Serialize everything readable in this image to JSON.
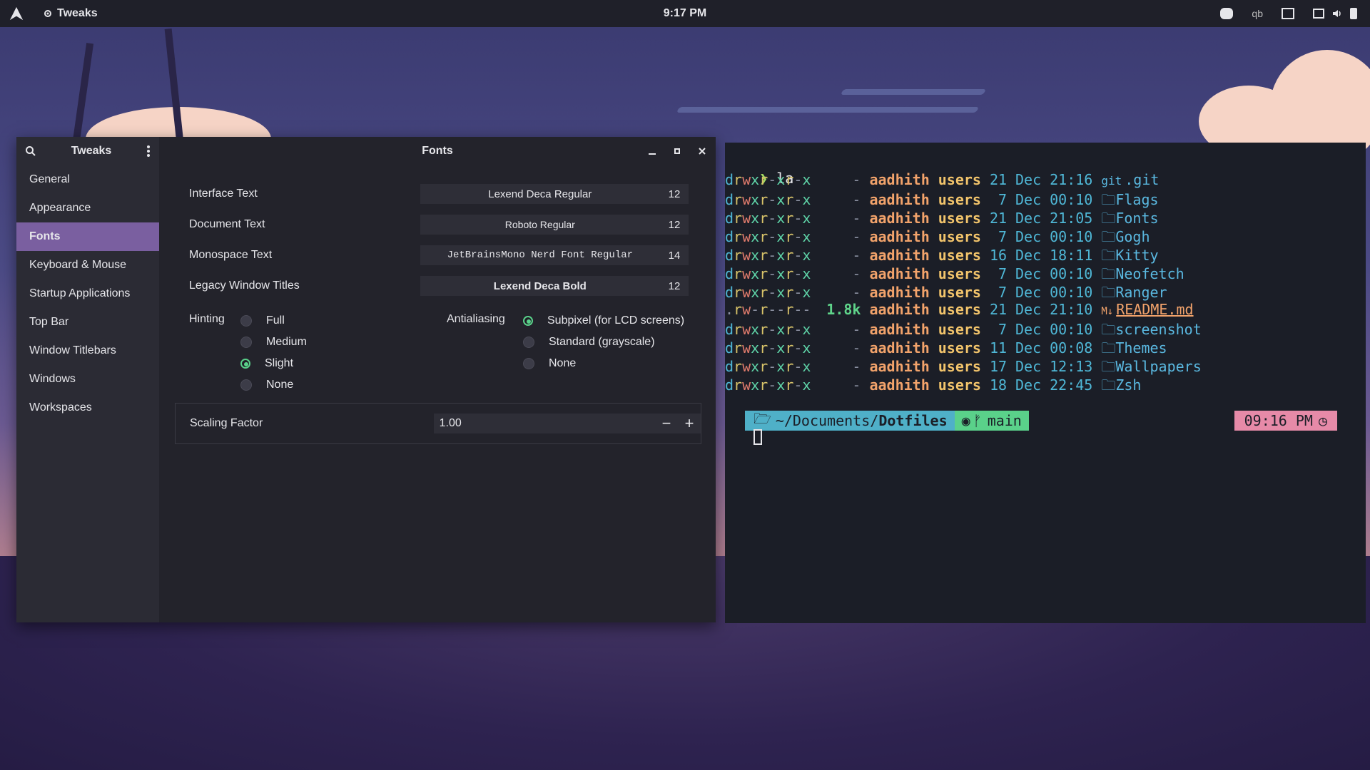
{
  "topbar": {
    "app_name": "Tweaks",
    "clock": "9:17 PM",
    "tray_qb": "qb"
  },
  "tweaks": {
    "title": "Tweaks",
    "panel_title": "Fonts",
    "sidebar": [
      {
        "label": "General"
      },
      {
        "label": "Appearance"
      },
      {
        "label": "Fonts",
        "active": true
      },
      {
        "label": "Keyboard & Mouse"
      },
      {
        "label": "Startup Applications"
      },
      {
        "label": "Top Bar"
      },
      {
        "label": "Window Titlebars"
      },
      {
        "label": "Windows"
      },
      {
        "label": "Workspaces"
      }
    ],
    "fonts": [
      {
        "label": "Interface Text",
        "font": "Lexend Deca Regular",
        "size": "12"
      },
      {
        "label": "Document Text",
        "font": "Roboto Regular",
        "size": "12"
      },
      {
        "label": "Monospace Text",
        "font": "JetBrainsMono Nerd Font Regular",
        "size": "14"
      },
      {
        "label": "Legacy Window Titles",
        "font": "Lexend Deca Bold",
        "size": "12"
      }
    ],
    "hinting": {
      "label": "Hinting",
      "options": [
        "Full",
        "Medium",
        "Slight",
        "None"
      ],
      "selected": "Slight"
    },
    "antialiasing": {
      "label": "Antialiasing",
      "options": [
        "Subpixel (for LCD screens)",
        "Standard (grayscale)",
        "None"
      ],
      "selected": "Subpixel (for LCD screens)"
    },
    "scaling": {
      "label": "Scaling Factor",
      "value": "1.00",
      "minus": "−",
      "plus": "+"
    }
  },
  "terminal": {
    "command": "la",
    "entries": [
      {
        "perms": "drwxr-xr-x",
        "size": "-",
        "user": "aadhith",
        "group": "users",
        "day": "21",
        "month": "Dec",
        "time": "21:16",
        "icon": "git",
        "name": ".git"
      },
      {
        "perms": "drwxr-xr-x",
        "size": "-",
        "user": "aadhith",
        "group": "users",
        "day": "7",
        "month": "Dec",
        "time": "00:10",
        "icon": "folder",
        "name": "Flags"
      },
      {
        "perms": "drwxr-xr-x",
        "size": "-",
        "user": "aadhith",
        "group": "users",
        "day": "21",
        "month": "Dec",
        "time": "21:05",
        "icon": "folder",
        "name": "Fonts"
      },
      {
        "perms": "drwxr-xr-x",
        "size": "-",
        "user": "aadhith",
        "group": "users",
        "day": "7",
        "month": "Dec",
        "time": "00:10",
        "icon": "folder",
        "name": "Gogh"
      },
      {
        "perms": "drwxr-xr-x",
        "size": "-",
        "user": "aadhith",
        "group": "users",
        "day": "16",
        "month": "Dec",
        "time": "18:11",
        "icon": "folder",
        "name": "Kitty"
      },
      {
        "perms": "drwxr-xr-x",
        "size": "-",
        "user": "aadhith",
        "group": "users",
        "day": "7",
        "month": "Dec",
        "time": "00:10",
        "icon": "folder",
        "name": "Neofetch"
      },
      {
        "perms": "drwxr-xr-x",
        "size": "-",
        "user": "aadhith",
        "group": "users",
        "day": "7",
        "month": "Dec",
        "time": "00:10",
        "icon": "folder",
        "name": "Ranger"
      },
      {
        "perms": ".rw-r--r--",
        "size": "1.8k",
        "user": "aadhith",
        "group": "users",
        "day": "21",
        "month": "Dec",
        "time": "21:10",
        "icon": "md",
        "name": "README.md"
      },
      {
        "perms": "drwxr-xr-x",
        "size": "-",
        "user": "aadhith",
        "group": "users",
        "day": "7",
        "month": "Dec",
        "time": "00:10",
        "icon": "folder",
        "name": "screenshot"
      },
      {
        "perms": "drwxr-xr-x",
        "size": "-",
        "user": "aadhith",
        "group": "users",
        "day": "11",
        "month": "Dec",
        "time": "00:08",
        "icon": "folder",
        "name": "Themes"
      },
      {
        "perms": "drwxr-xr-x",
        "size": "-",
        "user": "aadhith",
        "group": "users",
        "day": "17",
        "month": "Dec",
        "time": "12:13",
        "icon": "folder",
        "name": "Wallpapers"
      },
      {
        "perms": "drwxr-xr-x",
        "size": "-",
        "user": "aadhith",
        "group": "users",
        "day": "18",
        "month": "Dec",
        "time": "22:45",
        "icon": "folder",
        "name": "Zsh"
      }
    ],
    "prompt": {
      "path_prefix": "~/Documents/",
      "path_dir": "Dotfiles",
      "branch": "main",
      "time": "09:16 PM"
    }
  }
}
